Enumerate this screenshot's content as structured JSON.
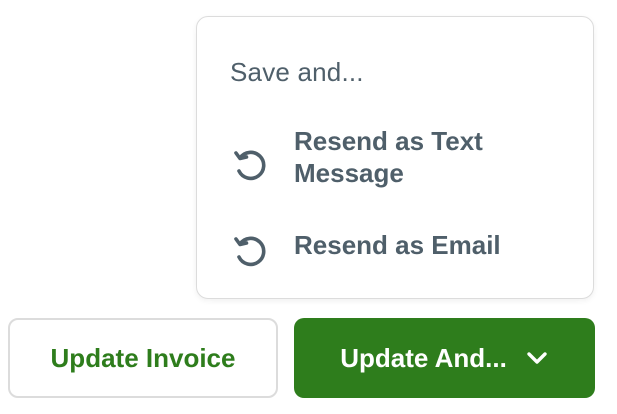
{
  "menu": {
    "header": "Save and...",
    "items": [
      {
        "label": "Resend as Text Message",
        "icon": "resend-icon"
      },
      {
        "label": "Resend as Email",
        "icon": "resend-icon"
      }
    ]
  },
  "buttons": {
    "update_invoice": "Update Invoice",
    "update_and": "Update And...",
    "update_and_icon": "chevron-down-icon"
  },
  "colors": {
    "brand_green": "#2e7d1c",
    "text_slate": "#4f5f6a",
    "border": "#dcdcdc"
  }
}
